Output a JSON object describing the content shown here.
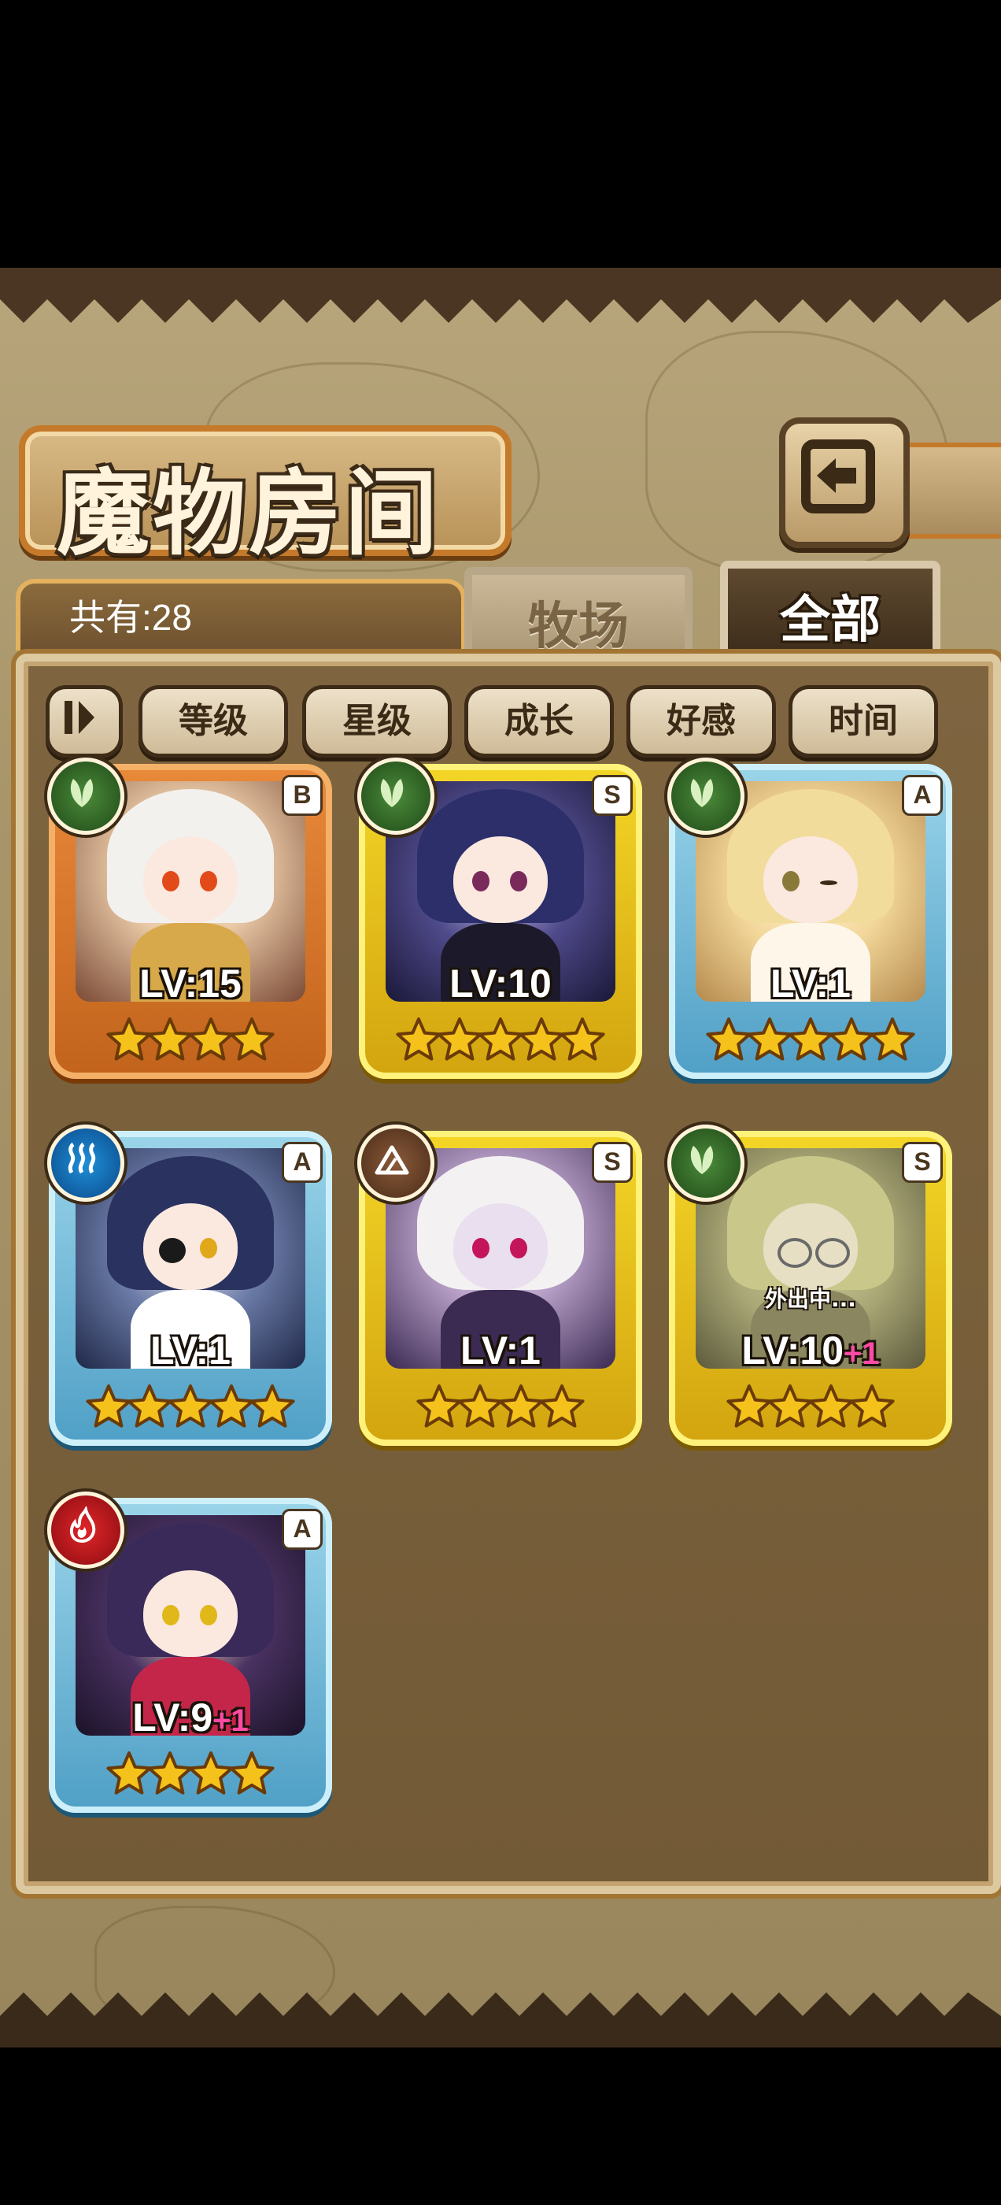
{
  "title": "魔物房间",
  "total_count": "共有:28",
  "tabs": [
    {
      "label": "牧场",
      "active": false
    },
    {
      "label": "全部",
      "active": true
    }
  ],
  "sort_buttons": [
    "等级",
    "星级",
    "成长",
    "好感",
    "时间"
  ],
  "cards": [
    {
      "grade": "B",
      "element": "leaf",
      "frame": "orange",
      "level": "LV:15",
      "level_bonus": "",
      "stars": 4,
      "status": ""
    },
    {
      "grade": "S",
      "element": "leaf",
      "frame": "gold",
      "level": "LV:10",
      "level_bonus": "",
      "stars": 5,
      "status": ""
    },
    {
      "grade": "A",
      "element": "leaf",
      "frame": "blue",
      "level": "LV:1",
      "level_bonus": "",
      "stars": 5,
      "status": ""
    },
    {
      "grade": "A",
      "element": "water",
      "frame": "blue",
      "level": "LV:1",
      "level_bonus": "",
      "stars": 5,
      "status": ""
    },
    {
      "grade": "S",
      "element": "earth",
      "frame": "gold",
      "level": "LV:1",
      "level_bonus": "",
      "stars": 4,
      "status": ""
    },
    {
      "grade": "S",
      "element": "leaf",
      "frame": "gold",
      "level": "LV:10",
      "level_bonus": "+1",
      "stars": 4,
      "status": "外出中..."
    },
    {
      "grade": "A",
      "element": "fire",
      "frame": "blue",
      "level": "LV:9",
      "level_bonus": "+1",
      "stars": 4,
      "status": ""
    }
  ],
  "colors": {
    "background": "#000000",
    "parchment": "#a8956a",
    "panel": "#7e6540",
    "star": "#f5c21c",
    "bonus": "#ff4aa6"
  }
}
